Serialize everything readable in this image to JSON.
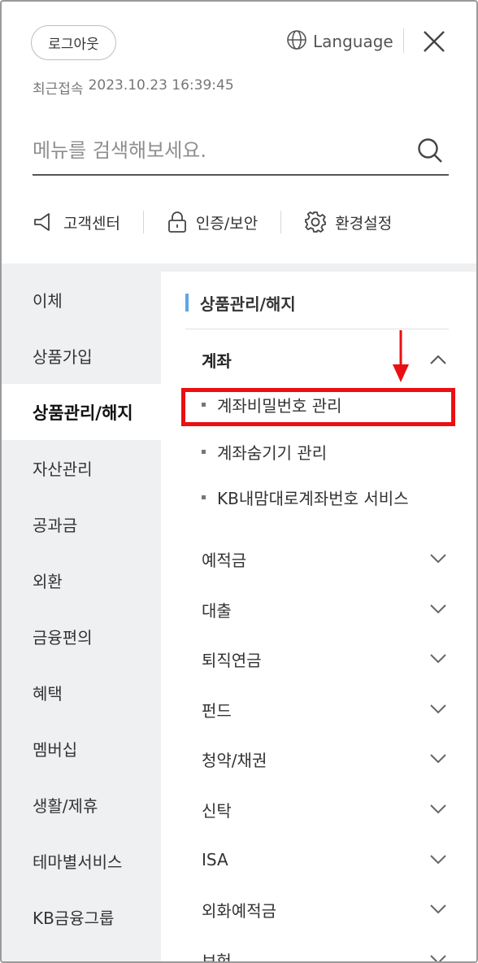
{
  "header": {
    "logout_label": "로그아웃",
    "language_label": "Language",
    "last_login_label": "최근접속",
    "last_login_value": "2023.10.23 16:39:45"
  },
  "search": {
    "placeholder": "메뉴를 검색해보세요."
  },
  "quick_links": [
    {
      "label": "고객센터",
      "icon": "megaphone-icon"
    },
    {
      "label": "인증/보안",
      "icon": "lock-icon"
    },
    {
      "label": "환경설정",
      "icon": "gear-icon"
    }
  ],
  "sidebar": {
    "items": [
      {
        "label": "이체"
      },
      {
        "label": "상품가입"
      },
      {
        "label": "상품관리/해지",
        "active": true
      },
      {
        "label": "자산관리"
      },
      {
        "label": "공과금"
      },
      {
        "label": "외환"
      },
      {
        "label": "금융편의"
      },
      {
        "label": "혜택"
      },
      {
        "label": "멤버십"
      },
      {
        "label": "생활/제휴"
      },
      {
        "label": "테마별서비스"
      },
      {
        "label": "KB금융그룹"
      }
    ]
  },
  "content": {
    "section_title": "상품관리/해지",
    "group_title": "계좌",
    "sub_items": [
      {
        "label": "계좌비밀번호 관리",
        "highlighted": true
      },
      {
        "label": "계좌숨기기 관리"
      },
      {
        "label": "KB내맘대로계좌번호 서비스"
      }
    ],
    "categories": [
      {
        "label": "예적금"
      },
      {
        "label": "대출"
      },
      {
        "label": "퇴직연금"
      },
      {
        "label": "펀드"
      },
      {
        "label": "청약/채권"
      },
      {
        "label": "신탁"
      },
      {
        "label": "ISA"
      },
      {
        "label": "외화예적금"
      },
      {
        "label": "보험"
      }
    ]
  },
  "colors": {
    "accent_bar": "#60a5e6",
    "highlight_red": "#ea0f12",
    "sidebar_bg": "#eef0f2"
  }
}
